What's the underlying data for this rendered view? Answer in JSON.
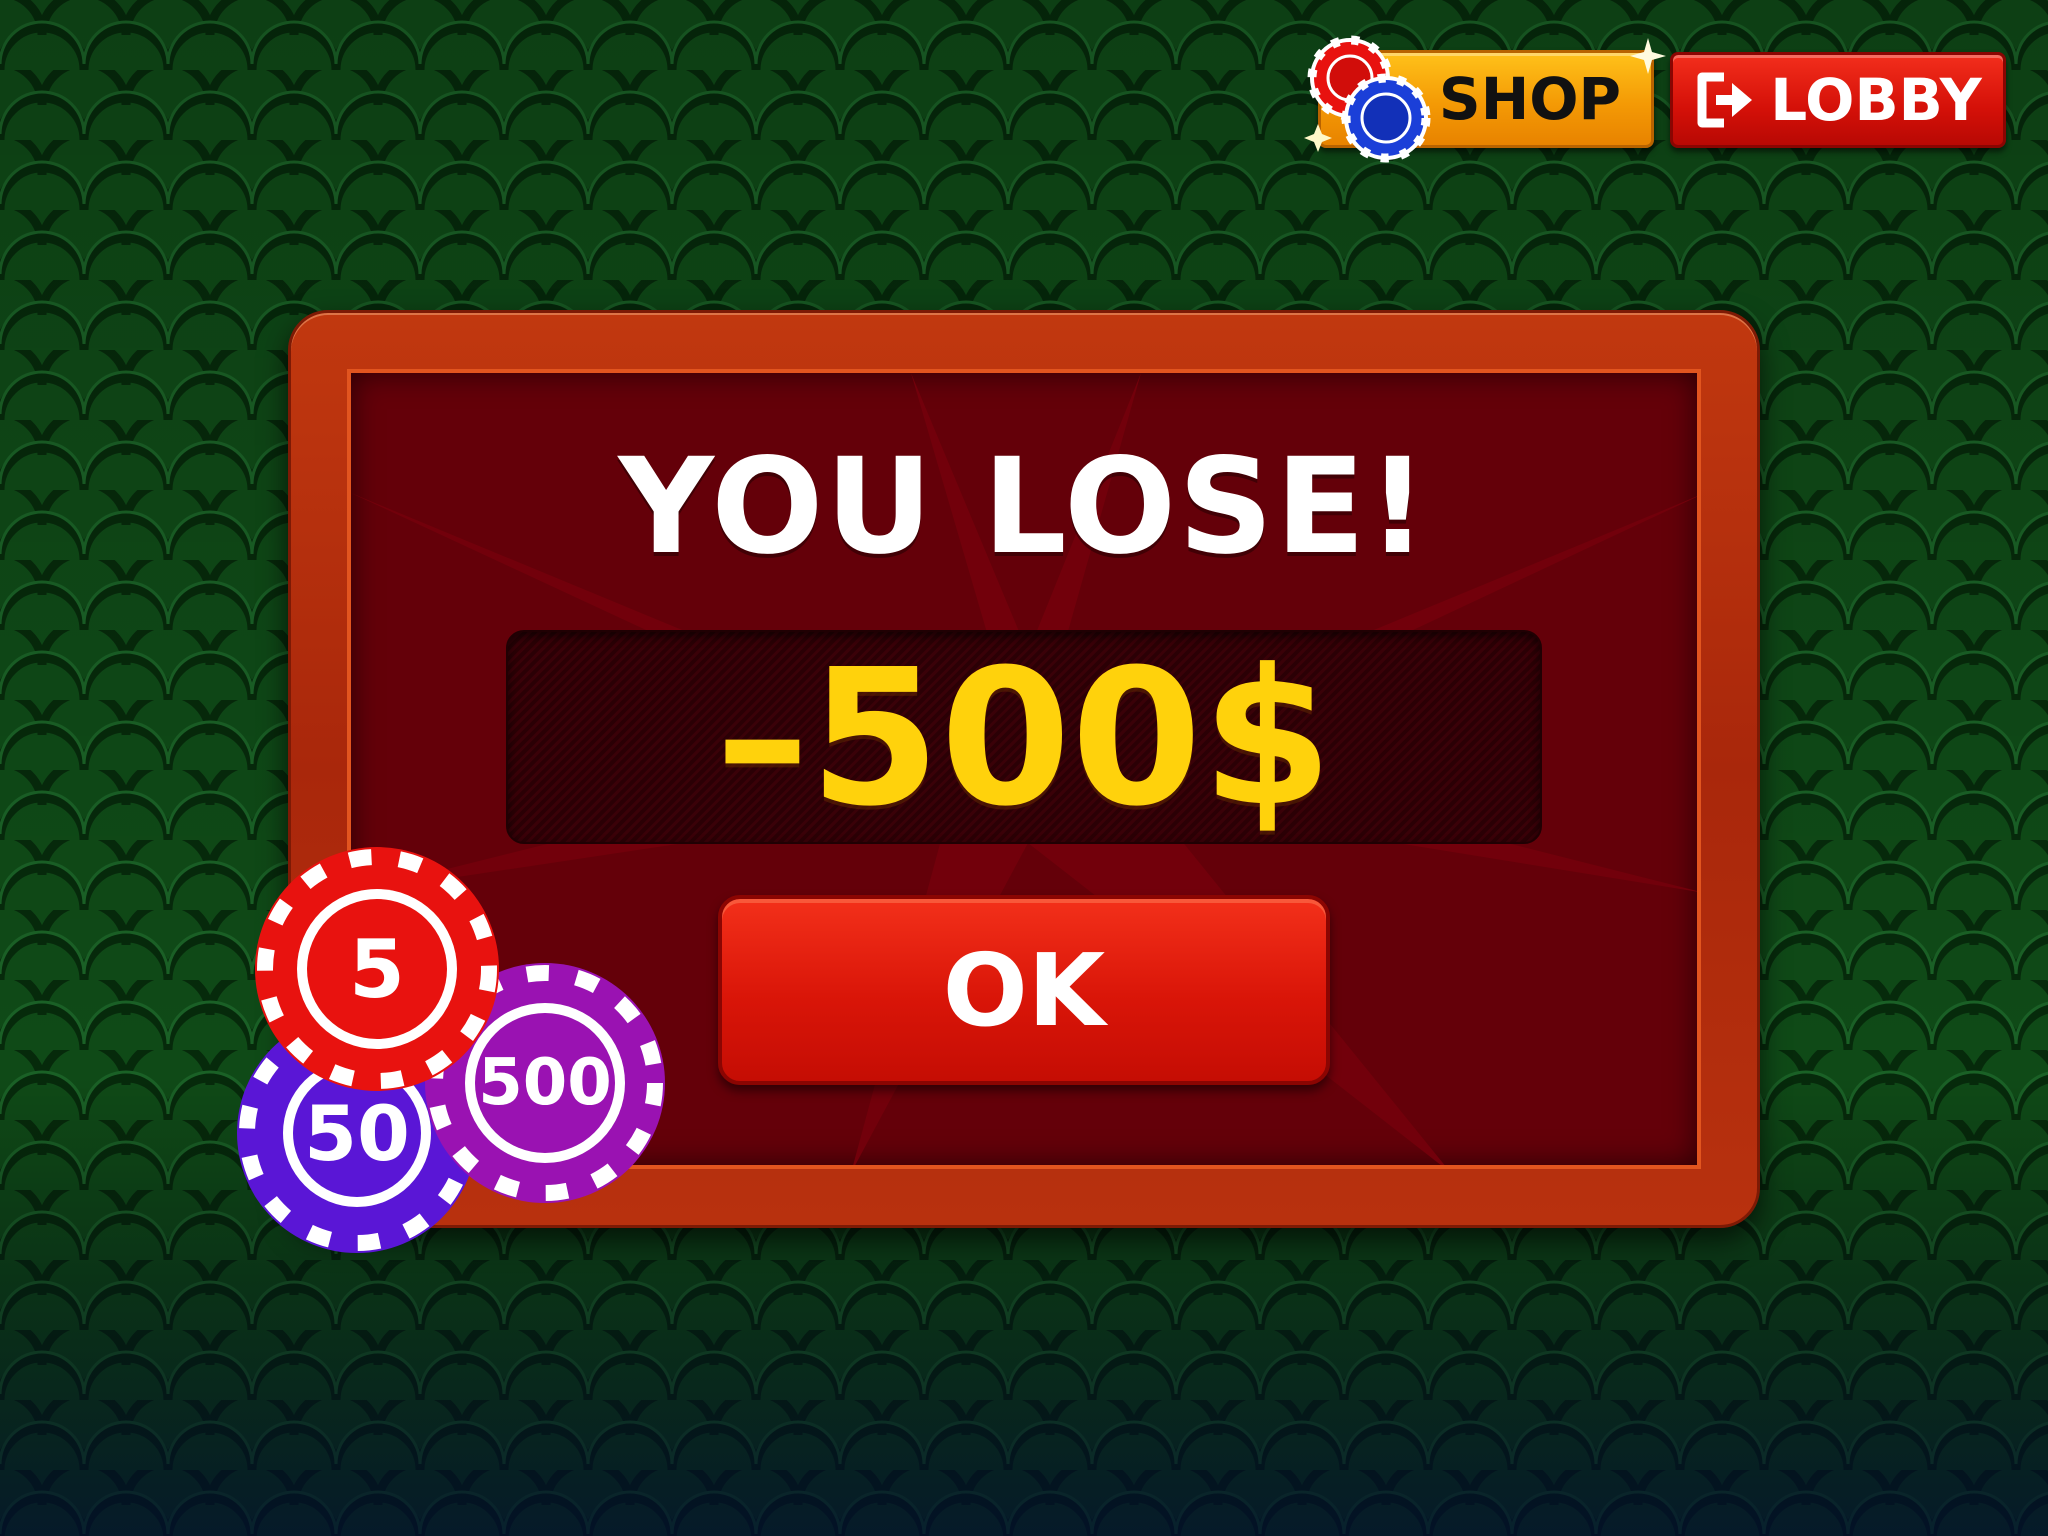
{
  "header": {
    "shop_label": "SHOP",
    "lobby_label": "LOBBY",
    "shop_icon": "poker-chips-icon",
    "lobby_icon": "exit-arrow-icon"
  },
  "dialog": {
    "title": "YOU LOSE!",
    "amount": "–500$",
    "ok_label": "OK"
  },
  "chips": [
    {
      "value": "5",
      "color": "#e8120f"
    },
    {
      "value": "50",
      "color": "#5a16d6"
    },
    {
      "value": "500",
      "color": "#9a12b2"
    }
  ],
  "colors": {
    "table_felt": "#0d3d13",
    "panel_wood": "#b12c0c",
    "panel_inner": "#640009",
    "amount_text": "#ffd20c",
    "shop_button": "#f7a80a",
    "lobby_button": "#d81209",
    "ok_button": "#d81508"
  }
}
